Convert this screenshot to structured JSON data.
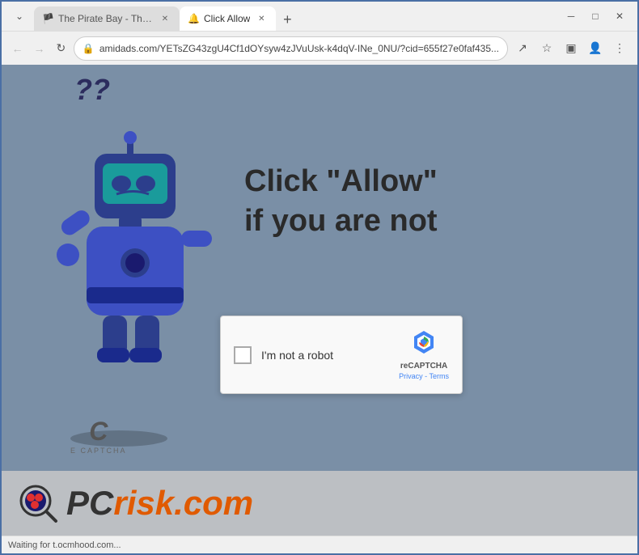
{
  "browser": {
    "title_bar": {
      "tab1": {
        "label": "The Pirate Bay - The galaxy's mo...",
        "favicon": "🏴",
        "active": false
      },
      "tab2": {
        "label": "Click Allow",
        "favicon": "🔔",
        "active": true
      },
      "new_tab_label": "+",
      "minimize": "─",
      "maximize": "□",
      "close": "✕",
      "dropdown": "⌄"
    },
    "nav_bar": {
      "back": "←",
      "forward": "→",
      "reload": "↻",
      "url": "amidads.com/YETsZG43zgU4Cf1dOYsyw4zJVuUsk-k4dqV-INe_0NU/?cid=655f27e0faf435...",
      "share": "↗",
      "bookmark": "☆",
      "split": "▣",
      "profile": "👤",
      "menu": "⋮"
    }
  },
  "page": {
    "background_color": "#7a8fa6",
    "question_marks": "??",
    "main_text_line1": "Click \"Allow\"",
    "main_text_line2": "if you are not",
    "captcha": {
      "checkbox_label": "I'm not a robot",
      "brand": "reCAPTCHA",
      "links": "Privacy - Terms"
    },
    "ecaptcha": {
      "letter": "C",
      "label": "E CAPTCHA"
    }
  },
  "watermark": {
    "site": "pcrisk.com",
    "pc_part": "PC",
    "risk_part": "risk.com"
  },
  "status_bar": {
    "text": "Waiting for t.ocmhood.com..."
  }
}
